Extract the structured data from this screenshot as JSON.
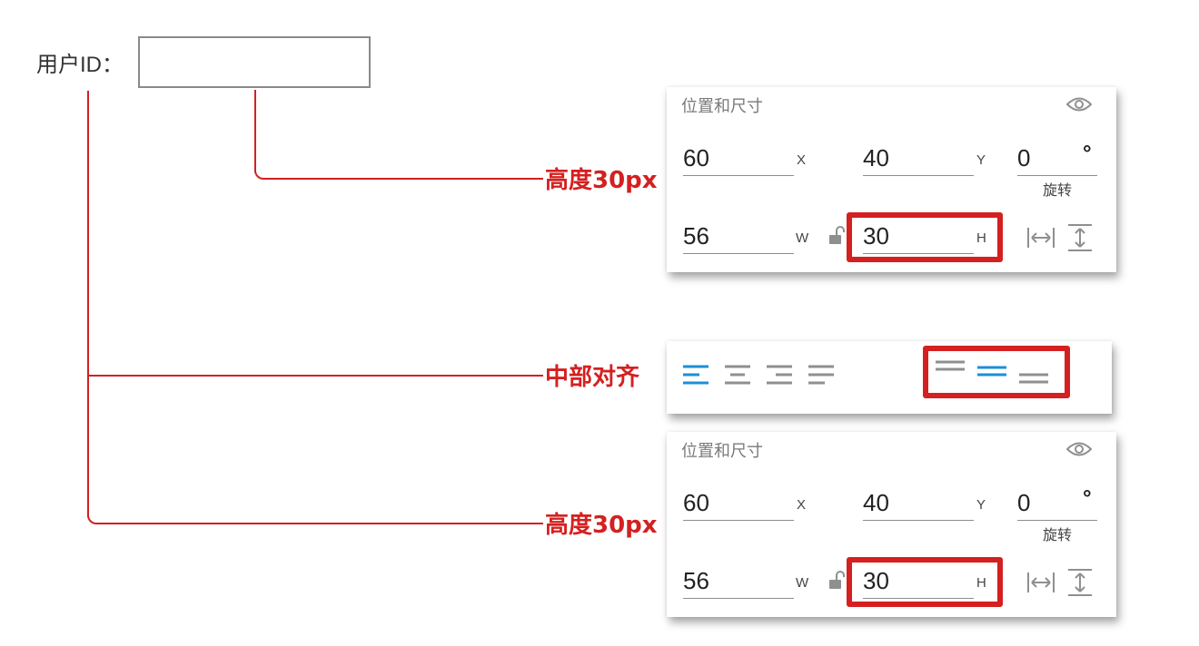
{
  "form": {
    "label": "用户ID：",
    "input_value": ""
  },
  "notes": {
    "height_top": "高度30px",
    "middle_align": "中部对齐",
    "height_bottom": "高度30px"
  },
  "panels": [
    {
      "title": "位置和尺寸",
      "x": {
        "value": "60",
        "label": "X"
      },
      "y": {
        "value": "40",
        "label": "Y"
      },
      "rotation": {
        "value": "0",
        "unit": "°",
        "label": "旋转"
      },
      "w": {
        "value": "56",
        "label": "W"
      },
      "h": {
        "value": "30",
        "label": "H"
      }
    },
    {
      "title": "位置和尺寸",
      "x": {
        "value": "60",
        "label": "X"
      },
      "y": {
        "value": "40",
        "label": "Y"
      },
      "rotation": {
        "value": "0",
        "unit": "°",
        "label": "旋转"
      },
      "w": {
        "value": "56",
        "label": "W"
      },
      "h": {
        "value": "30",
        "label": "H"
      }
    }
  ],
  "colors": {
    "annotation_red": "#d42020",
    "accent_blue": "#1a8fd8",
    "icon_gray": "#8f8f8f"
  },
  "icons": {
    "eye": "eye-icon",
    "lock": "unlock-icon",
    "fit_width": "fit-width-icon",
    "fit_height": "fit-height-icon",
    "text_align": [
      "text-align-left-icon",
      "text-align-center-icon",
      "text-align-right-icon",
      "text-align-justify-icon"
    ],
    "vertical_align": [
      "vertical-align-top-icon",
      "vertical-align-middle-icon",
      "vertical-align-bottom-icon"
    ]
  },
  "alignment": {
    "horizontal_selected": "left",
    "vertical_selected": "middle"
  }
}
